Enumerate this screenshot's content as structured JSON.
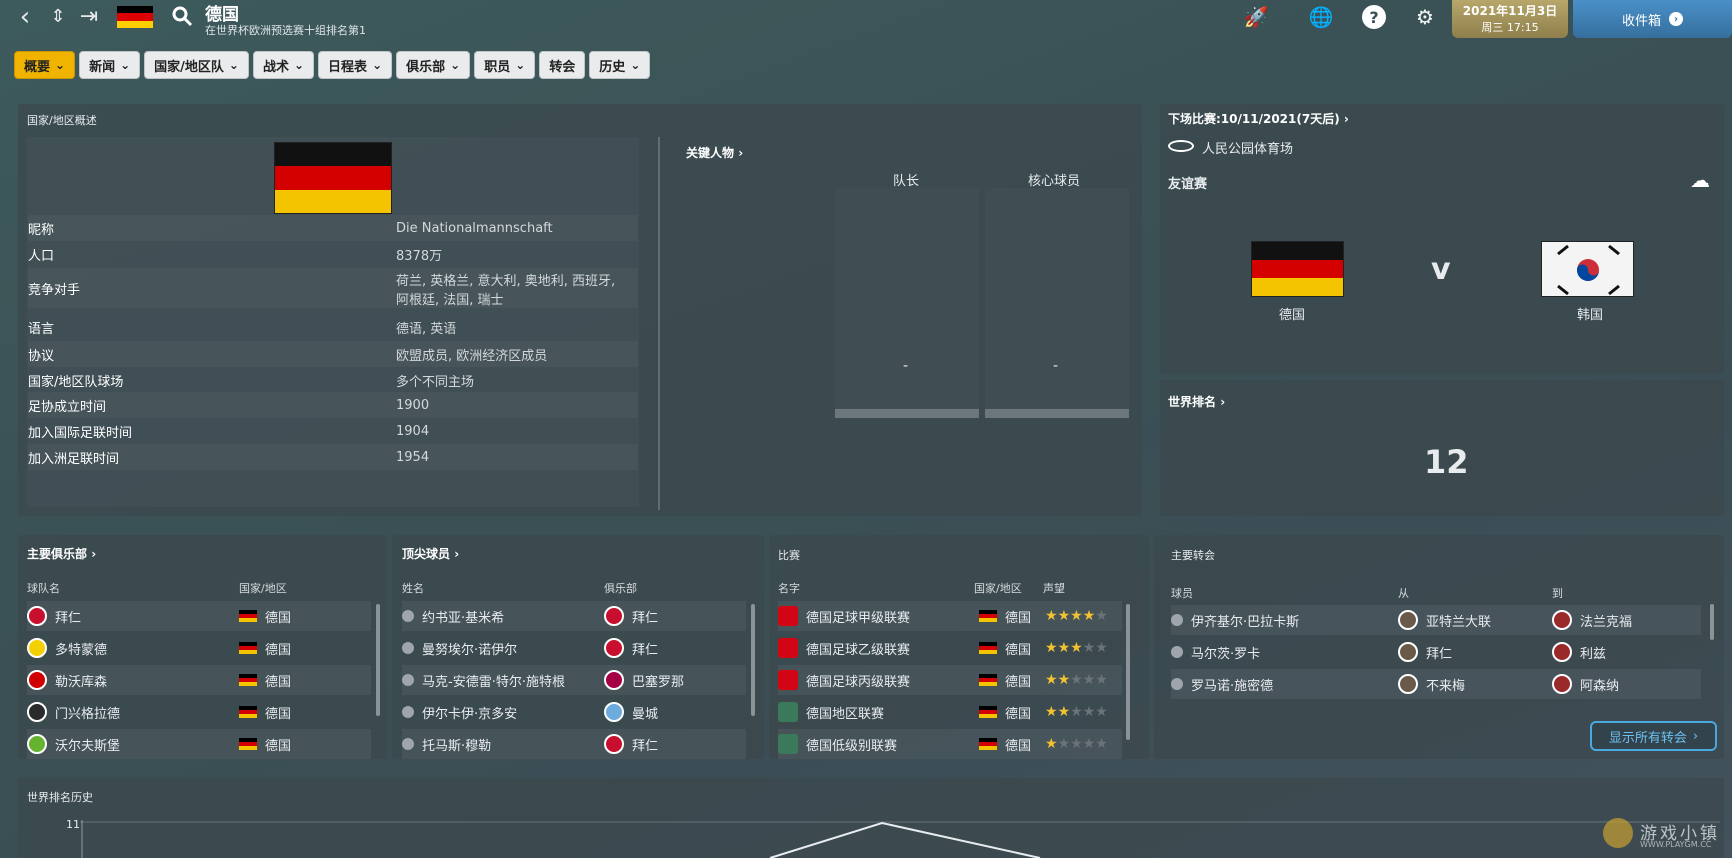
{
  "header": {
    "title": "德国",
    "subtitle": "在世界杯欧洲预选赛十组排名第1",
    "date": "2021年11月3日",
    "time": "周三 17:15",
    "inbox": "收件箱"
  },
  "tabs": [
    {
      "label": "概要",
      "dropdown": true,
      "active": true
    },
    {
      "label": "新闻",
      "dropdown": true
    },
    {
      "label": "国家/地区队",
      "dropdown": true
    },
    {
      "label": "战术",
      "dropdown": true
    },
    {
      "label": "日程表",
      "dropdown": true
    },
    {
      "label": "俱乐部",
      "dropdown": true
    },
    {
      "label": "职员",
      "dropdown": true
    },
    {
      "label": "转会",
      "dropdown": false
    },
    {
      "label": "历史",
      "dropdown": true
    }
  ],
  "overview": {
    "label": "国家/地区概述",
    "rows": [
      {
        "k": "昵称",
        "v": "Die Nationalmannschaft"
      },
      {
        "k": "人口",
        "v": "8378万"
      },
      {
        "k": "竞争对手",
        "v": "荷兰, 英格兰, 意大利, 奥地利, 西班牙,",
        "v2": "阿根廷, 法国, 瑞士"
      },
      {
        "k": "语言",
        "v": "德语, 英语"
      },
      {
        "k": "协议",
        "v": "欧盟成员, 欧洲经济区成员"
      },
      {
        "k": "国家/地区队球场",
        "v": "多个不同主场"
      },
      {
        "k": "足协成立时间",
        "v": "1900"
      },
      {
        "k": "加入国际足联时间",
        "v": "1904"
      },
      {
        "k": "加入洲足联时间",
        "v": "1954"
      }
    ]
  },
  "key_people": {
    "label": "关键人物",
    "captain": "队长",
    "core": "核心球员",
    "captain_val": "-",
    "core_val": "-"
  },
  "next_match": {
    "label": "下场比赛:10/11/2021(7天后)",
    "stadium": "人民公园体育场",
    "type": "友谊赛",
    "home": "德国",
    "away": "韩国",
    "vs": "v"
  },
  "world_rank": {
    "label": "世界排名",
    "value": "12"
  },
  "clubs": {
    "label": "主要俱乐部",
    "col1": "球队名",
    "col2": "国家/地区",
    "items": [
      {
        "name": "拜仁",
        "country": "德国",
        "badge": "#c8102e"
      },
      {
        "name": "多特蒙德",
        "country": "德国",
        "badge": "#f5d000"
      },
      {
        "name": "勒沃库森",
        "country": "德国",
        "badge": "#d00000"
      },
      {
        "name": "门兴格拉德",
        "country": "德国",
        "badge": "#2a2a2a"
      },
      {
        "name": "沃尔夫斯堡",
        "country": "德国",
        "badge": "#65b32e"
      }
    ]
  },
  "players": {
    "label": "顶尖球员",
    "col1": "姓名",
    "col2": "俱乐部",
    "items": [
      {
        "name": "约书亚·基米希",
        "club": "拜仁",
        "badge": "#c8102e"
      },
      {
        "name": "曼努埃尔·诺伊尔",
        "club": "拜仁",
        "badge": "#c8102e"
      },
      {
        "name": "马克-安德雷·特尔·施特根",
        "club": "巴塞罗那",
        "badge": "#a50044"
      },
      {
        "name": "伊尔卡伊·京多安",
        "club": "曼城",
        "badge": "#6cabdd"
      },
      {
        "name": "托马斯·穆勒",
        "club": "拜仁",
        "badge": "#c8102e"
      }
    ]
  },
  "competitions": {
    "label": "比赛",
    "col1": "名字",
    "col2": "国家/地区",
    "col3": "声望",
    "items": [
      {
        "name": "德国足球甲级联赛",
        "country": "德国",
        "stars": 4
      },
      {
        "name": "德国足球乙级联赛",
        "country": "德国",
        "stars": 3
      },
      {
        "name": "德国足球丙级联赛",
        "country": "德国",
        "stars": 2
      },
      {
        "name": "德国地区联赛",
        "country": "德国",
        "stars": 2
      },
      {
        "name": "德国低级别联赛",
        "country": "德国",
        "stars": 1
      }
    ]
  },
  "transfers": {
    "label": "主要转会",
    "col1": "球员",
    "col2": "从",
    "col3": "到",
    "button": "显示所有转会",
    "items": [
      {
        "player": "伊齐基尔·巴拉卡斯",
        "from": "亚特兰大联",
        "to": "法兰克福"
      },
      {
        "player": "马尔茨·罗卡",
        "from": "拜仁",
        "to": "利兹"
      },
      {
        "player": "罗马诺·施密德",
        "from": "不来梅",
        "to": "阿森纳"
      }
    ]
  },
  "rank_history": {
    "label": "世界排名历史",
    "ymax": "11"
  },
  "watermark": {
    "text": "游戏小镇",
    "url": "WWW.PLAYGM.CC"
  },
  "colors": {
    "accent": "#f0b400",
    "germany": [
      "#000000",
      "#dd0000",
      "#ffce00"
    ],
    "inbox": "#4a90c8"
  }
}
